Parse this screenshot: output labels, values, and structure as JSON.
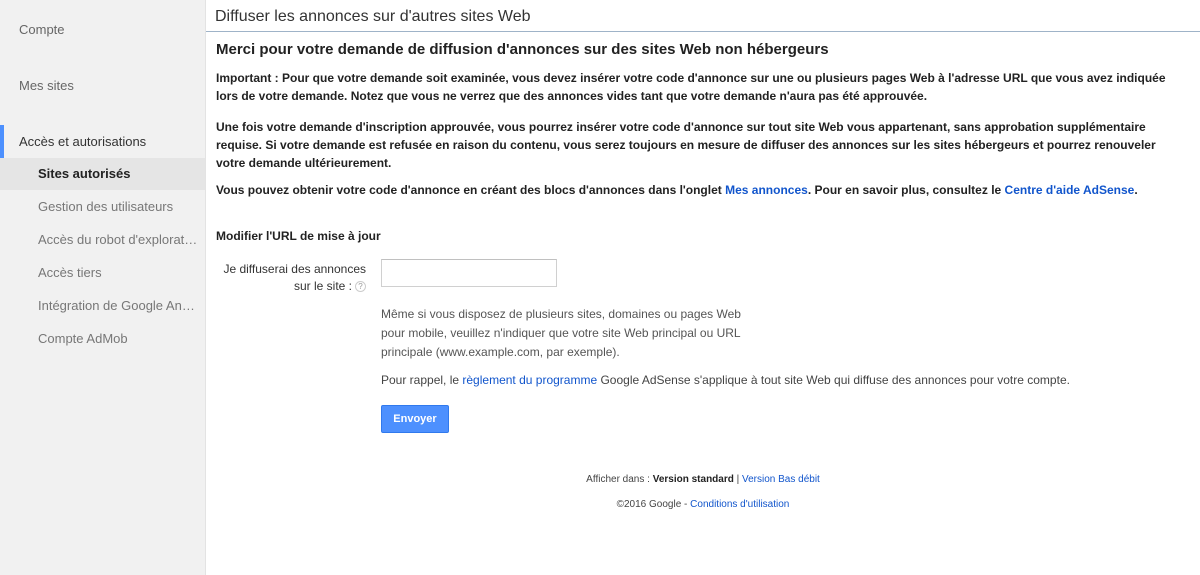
{
  "sidebar": {
    "account": "Compte",
    "my_sites": "Mes sites",
    "section": "Accès et autorisations",
    "items": [
      {
        "label": "Sites autorisés"
      },
      {
        "label": "Gestion des utilisateurs"
      },
      {
        "label": "Accès du robot d'exploration"
      },
      {
        "label": "Accès tiers"
      },
      {
        "label": "Intégration de Google Analytics"
      },
      {
        "label": "Compte AdMob"
      }
    ]
  },
  "header": {
    "title": "Diffuser les annonces sur d'autres sites Web"
  },
  "main": {
    "heading": "Merci pour votre demande de diffusion d'annonces sur des sites Web non hébergeurs",
    "para1": "Important : Pour que votre demande soit examinée, vous devez insérer votre code d'annonce sur une ou plusieurs pages Web à l'adresse URL que vous avez indiquée lors de votre demande. Notez que vous ne verrez que des annonces vides tant que votre demande n'aura pas été approuvée.",
    "para2": "Une fois votre demande d'inscription approuvée, vous pourrez insérer votre code d'annonce sur tout site Web vous appartenant, sans approbation supplémentaire requise. Si votre demande est refusée en raison du contenu, vous serez toujours en mesure de diffuser des annonces sur les sites hébergeurs et pourrez renouveler votre demande ultérieurement.",
    "para3_prefix": "Vous pouvez obtenir votre code d'annonce en créant des blocs d'annonces dans l'onglet ",
    "para3_link1": "Mes annonces",
    "para3_middle": ". Pour en savoir plus, consultez le ",
    "para3_link2": "Centre d'aide AdSense",
    "para3_suffix": ".",
    "update_heading": "Modifier l'URL de mise à jour",
    "field_label": "Je diffuserai des annonces sur le site :",
    "help_icon_glyph": "?",
    "field_value": "",
    "hint": "Même si vous disposez de plusieurs sites, domaines ou pages Web pour mobile, veuillez n'indiquer que votre site Web principal ou URL principale (www.example.com, par exemple).",
    "reminder_prefix": "Pour rappel, le ",
    "reminder_link": "règlement du programme",
    "reminder_suffix": " Google AdSense s'applique à tout site Web qui diffuse des annonces pour votre compte.",
    "submit_label": "Envoyer"
  },
  "footer": {
    "display_prefix": "Afficher dans : ",
    "standard": "Version standard",
    "separator": " | ",
    "low_bandwidth": "Version Bas débit",
    "copyright": "©2016 Google - ",
    "terms": "Conditions d'utilisation"
  },
  "colors": {
    "accent": "#4d90fe",
    "link": "#1155cc",
    "sidebar_bg": "#f1f1f1"
  }
}
